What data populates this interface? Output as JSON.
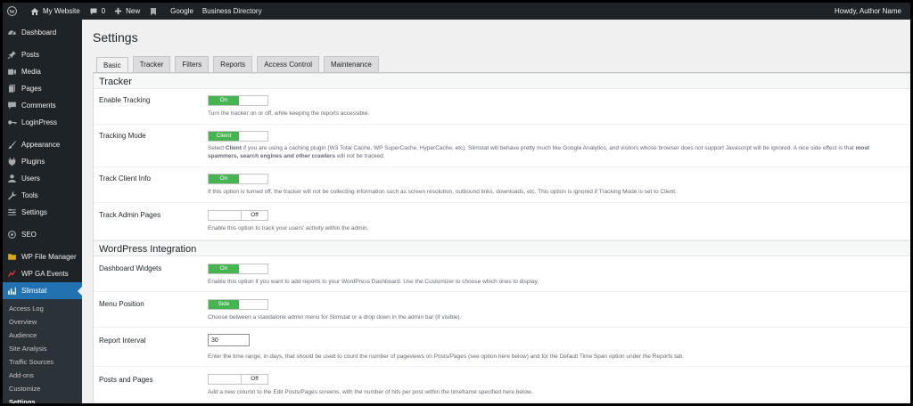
{
  "adminbar": {
    "site_name": "My Website",
    "comments_count": "0",
    "new_label": "New",
    "google_label": "Google",
    "business_directory_label": "Business Directory",
    "howdy": "Howdy, Author Name"
  },
  "sidebar": {
    "dashboard": "Dashboard",
    "posts": "Posts",
    "media": "Media",
    "pages": "Pages",
    "comments": "Comments",
    "loginpress": "LoginPress",
    "appearance": "Appearance",
    "plugins": "Plugins",
    "users": "Users",
    "tools": "Tools",
    "settings": "Settings",
    "seo": "SEO",
    "wp_file_manager": "WP File Manager",
    "wp_ga_events": "WP GA Events",
    "slimstat": "Slimstat",
    "submenu": [
      "Access Log",
      "Overview",
      "Audience",
      "Site Analysis",
      "Traffic Sources",
      "Add-ons",
      "Customize",
      "Settings"
    ]
  },
  "page": {
    "title": "Settings",
    "tabs": [
      "Basic",
      "Tracker",
      "Filters",
      "Reports",
      "Access Control",
      "Maintenance"
    ]
  },
  "sections": {
    "tracker": "Tracker",
    "wp_integration": "WordPress Integration"
  },
  "rows": {
    "enable_tracking": {
      "label": "Enable Tracking",
      "value": "On",
      "desc": "Turn the tracker on or off, while keeping the reports accessible."
    },
    "tracking_mode": {
      "label": "Tracking Mode",
      "value": "Client",
      "desc_1": "Select ",
      "desc_bold_1": "Client",
      "desc_2": " if you are using a caching plugin (W3 Total Cache, WP SuperCache, HyperCache, etc). Slimstat will behave pretty much like Google Analytics, and visitors whose browser does not support Javascript will be ignored. A nice side effect is that ",
      "desc_bold_2": "most spammers, search engines and other crawlers",
      "desc_3": " will not be tracked."
    },
    "track_client_info": {
      "label": "Track Client Info",
      "value": "On",
      "desc": "If this option is turned off, the tracker will not be collecting information such as screen resolution, outbound links, downloads, etc. This option is ignored if Tracking Mode is set to Client."
    },
    "track_admin_pages": {
      "label": "Track Admin Pages",
      "value": "Off",
      "desc": "Enable this option to track your users' activity within the admin."
    },
    "dashboard_widgets": {
      "label": "Dashboard Widgets",
      "value": "On",
      "desc": "Enable this option if you want to add reports to your WordPress Dashboard. Use the Customizer to choose which ones to display."
    },
    "menu_position": {
      "label": "Menu Position",
      "value": "Side",
      "desc": "Choose between a standalone admin menu for Slimstat or a drop down in the admin bar (if visible)."
    },
    "report_interval": {
      "label": "Report Interval",
      "value": "30",
      "desc": "Enter the time range, in days, that should be used to count the number of pageviews on Posts/Pages (see option here below) and for the Default Time Span option under the Reports tab."
    },
    "posts_and_pages": {
      "label": "Posts and Pages",
      "value": "Off",
      "desc": "Add a new column to the Edit Posts/Pages screens, with the number of hits per post within the timeframe specified here below."
    }
  },
  "colors": {
    "admin_dark": "#1d2327",
    "accent_blue": "#2271b1",
    "toggle_green": "#46b450"
  }
}
